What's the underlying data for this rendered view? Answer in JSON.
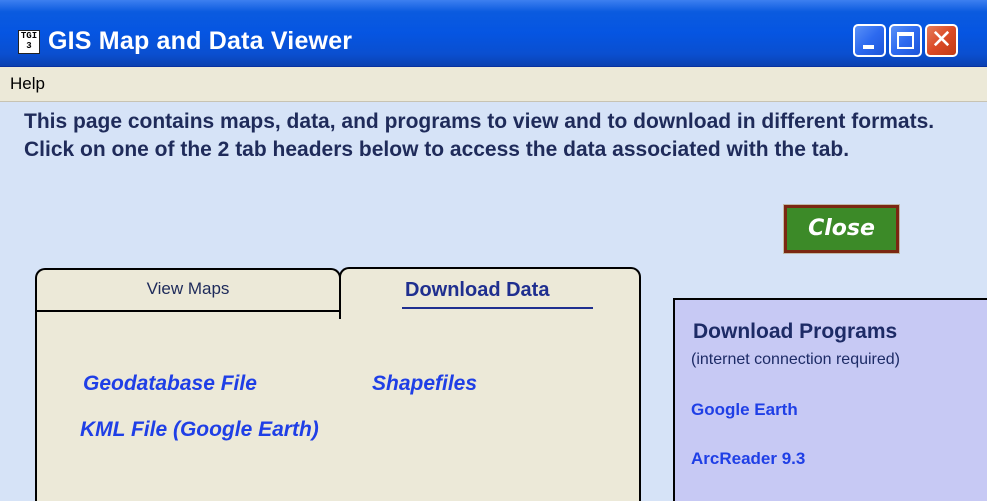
{
  "window": {
    "title": "GIS Map and Data Viewer",
    "app_icon_text": "TGI 3"
  },
  "menubar": {
    "items": [
      "Help"
    ]
  },
  "intro_text": "This page contains maps, data, and programs to view and to download in different formats.  Click on one of the 2 tab headers below to access the data associated with the tab.",
  "close_button_label": "Close",
  "tabs": [
    {
      "label": "View Maps",
      "selected": false
    },
    {
      "label": "Download Data",
      "selected": true
    }
  ],
  "download_data": {
    "links": [
      "Geodatabase File",
      "Shapefiles",
      "KML File (Google Earth)"
    ]
  },
  "download_programs": {
    "title": "Download Programs",
    "subtitle": "(internet connection required)",
    "links": [
      "Google Earth",
      "ArcReader 9.3"
    ]
  },
  "colors": {
    "titlebar": "#0555e2",
    "window_bg": "#d6e3f7",
    "panel_bg": "#ece9d8",
    "programs_bg": "#c7c9f4",
    "link": "#1f3fe6",
    "close_button": "#3c8a28"
  }
}
